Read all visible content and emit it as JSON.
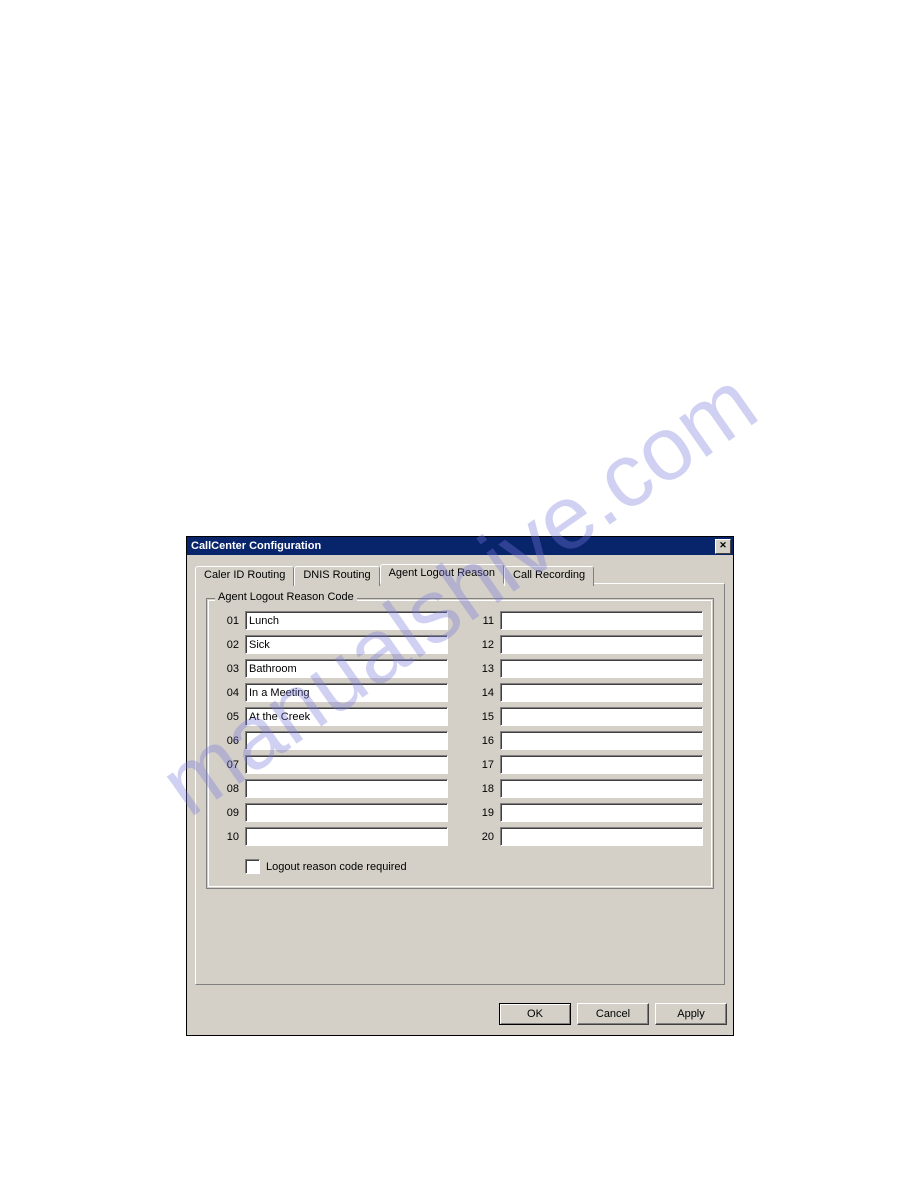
{
  "watermark": "manualshive.com",
  "dialog": {
    "title": "CallCenter Configuration",
    "tabs": [
      {
        "label": "Caler ID Routing"
      },
      {
        "label": "DNIS Routing"
      },
      {
        "label": "Agent Logout Reason"
      },
      {
        "label": "Call Recording"
      }
    ],
    "group_legend": "Agent Logout Reason Code",
    "rows_left": [
      {
        "num": "01",
        "value": "Lunch"
      },
      {
        "num": "02",
        "value": "Sick"
      },
      {
        "num": "03",
        "value": "Bathroom"
      },
      {
        "num": "04",
        "value": "In a Meeting"
      },
      {
        "num": "05",
        "value": "At the Creek"
      },
      {
        "num": "06",
        "value": ""
      },
      {
        "num": "07",
        "value": ""
      },
      {
        "num": "08",
        "value": ""
      },
      {
        "num": "09",
        "value": ""
      },
      {
        "num": "10",
        "value": ""
      }
    ],
    "rows_right": [
      {
        "num": "11",
        "value": ""
      },
      {
        "num": "12",
        "value": ""
      },
      {
        "num": "13",
        "value": ""
      },
      {
        "num": "14",
        "value": ""
      },
      {
        "num": "15",
        "value": ""
      },
      {
        "num": "16",
        "value": ""
      },
      {
        "num": "17",
        "value": ""
      },
      {
        "num": "18",
        "value": ""
      },
      {
        "num": "19",
        "value": ""
      },
      {
        "num": "20",
        "value": ""
      }
    ],
    "checkbox_label": "Logout reason code required",
    "buttons": {
      "ok": "OK",
      "cancel": "Cancel",
      "apply": "Apply"
    }
  }
}
